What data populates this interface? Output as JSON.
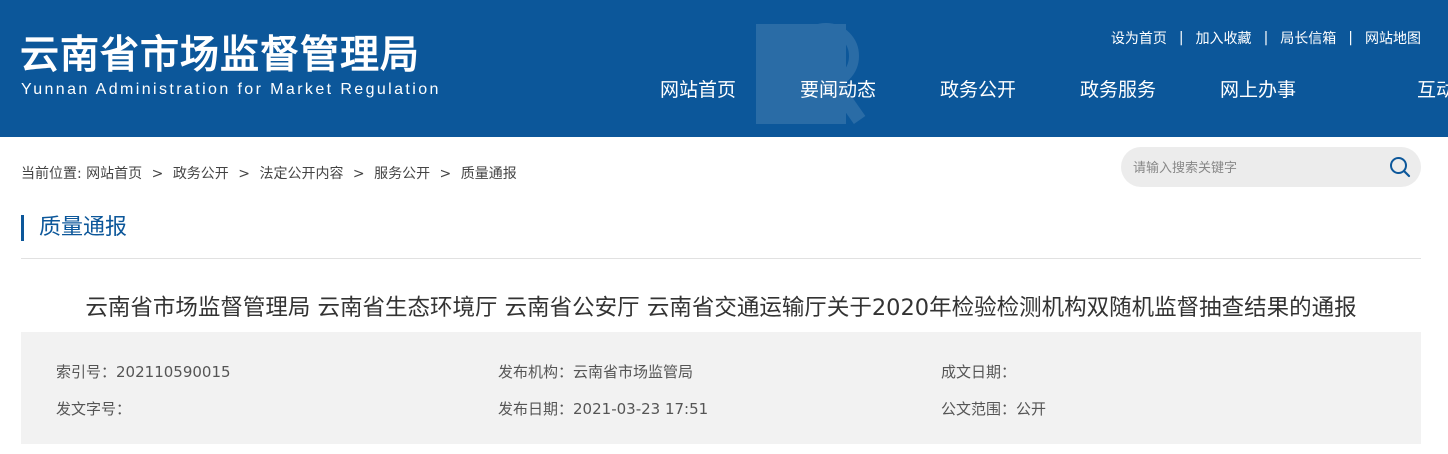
{
  "header": {
    "logo_cn": "云南省市场监督管理局",
    "logo_en": "Yunnan Administration for Market Regulation",
    "toplinks": [
      "设为首页",
      "加入收藏",
      "局长信箱",
      "网站地图"
    ],
    "nav": [
      "网站首页",
      "要闻动态",
      "政务公开",
      "政务服务",
      "网上办事",
      "互动交流"
    ],
    "bg_color": "#0c579a"
  },
  "breadcrumb": {
    "prefix": "当前位置:",
    "items": [
      "网站首页",
      "政务公开",
      "法定公开内容",
      "服务公开",
      "质量通报"
    ],
    "separator": ">"
  },
  "search": {
    "placeholder": "请输入搜索关键字",
    "icon": "search-icon"
  },
  "section": {
    "title": "质量通报"
  },
  "article": {
    "title": "云南省市场监督管理局 云南省生态环境厅 云南省公安厅 云南省交通运输厅关于2020年检验检测机构双随机监督抽查结果的通报"
  },
  "meta": {
    "index_label": "索引号：",
    "index_value": "202110590015",
    "publisher_label": "发布机构：",
    "publisher_value": "云南省市场监管局",
    "written_date_label": "成文日期：",
    "written_date_value": "",
    "doc_number_label": "发文字号：",
    "doc_number_value": "",
    "publish_date_label": "发布日期：",
    "publish_date_value": "2021-03-23 17:51",
    "scope_label": "公文范围：",
    "scope_value": "公开"
  }
}
